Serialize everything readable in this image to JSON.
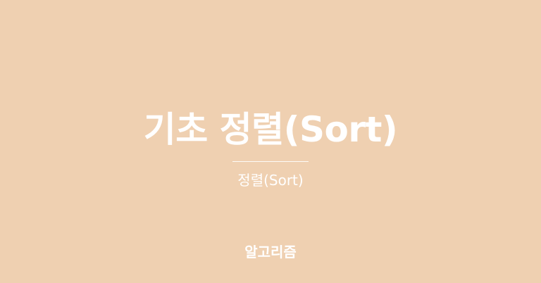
{
  "post": {
    "title": "기초 정렬(Sort)",
    "subtitle": "정렬(Sort)",
    "category": "알고리즘"
  },
  "colors": {
    "background": "#efd0b1",
    "text": "#ffffff"
  }
}
